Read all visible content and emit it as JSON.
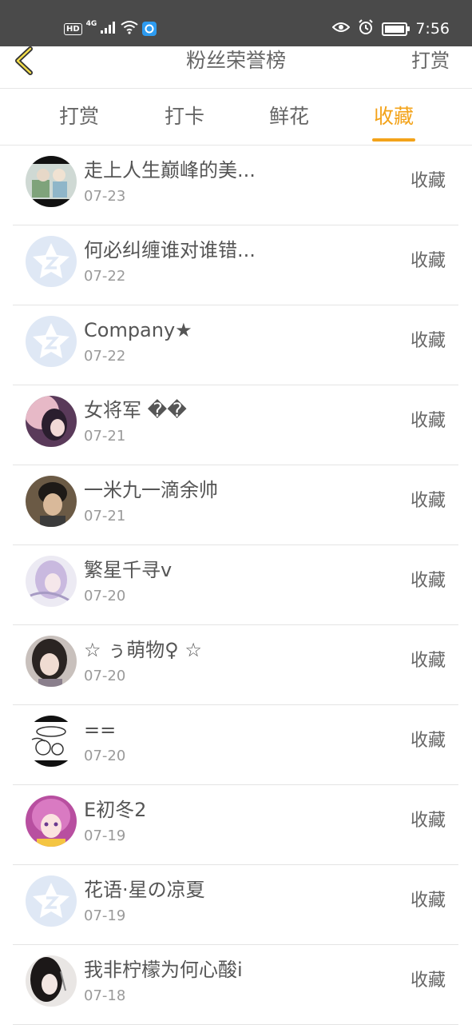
{
  "status_bar": {
    "hd": "HD",
    "network": "4G",
    "time": "7:56"
  },
  "header": {
    "title": "粉丝荣誉榜",
    "action": "打赏"
  },
  "tabs": [
    {
      "label": "打赏",
      "active": false
    },
    {
      "label": "打卡",
      "active": false
    },
    {
      "label": "鲜花",
      "active": false
    },
    {
      "label": "收藏",
      "active": true
    }
  ],
  "list": [
    {
      "name": "走上人生巅峰的美...",
      "date": "07-23",
      "action": "收藏",
      "avatar": "photo"
    },
    {
      "name": "何必纠缠谁对谁错...",
      "date": "07-22",
      "action": "收藏",
      "avatar": "default"
    },
    {
      "name": "Company★",
      "date": "07-22",
      "action": "收藏",
      "avatar": "default"
    },
    {
      "name": "女将军 ��",
      "date": "07-21",
      "action": "收藏",
      "avatar": "photo"
    },
    {
      "name": "一米九一滴余帅",
      "date": "07-21",
      "action": "收藏",
      "avatar": "photo"
    },
    {
      "name": "繁星千寻v",
      "date": "07-20",
      "action": "收藏",
      "avatar": "photo"
    },
    {
      "name": "☆ ぅ萌物♀ ☆",
      "date": "07-20",
      "action": "收藏",
      "avatar": "photo"
    },
    {
      "name": "==",
      "date": "07-20",
      "action": "收藏",
      "avatar": "sketch"
    },
    {
      "name": "E初冬2",
      "date": "07-19",
      "action": "收藏",
      "avatar": "photo"
    },
    {
      "name": "花语·星の凉夏",
      "date": "07-19",
      "action": "收藏",
      "avatar": "default"
    },
    {
      "name": "我非柠檬为何心酸i",
      "date": "07-18",
      "action": "收藏",
      "avatar": "photo"
    }
  ],
  "colors": {
    "accent": "#f3a31a",
    "statusbar": "#4a4a4a",
    "default_avatar": "#dfe8f5"
  }
}
